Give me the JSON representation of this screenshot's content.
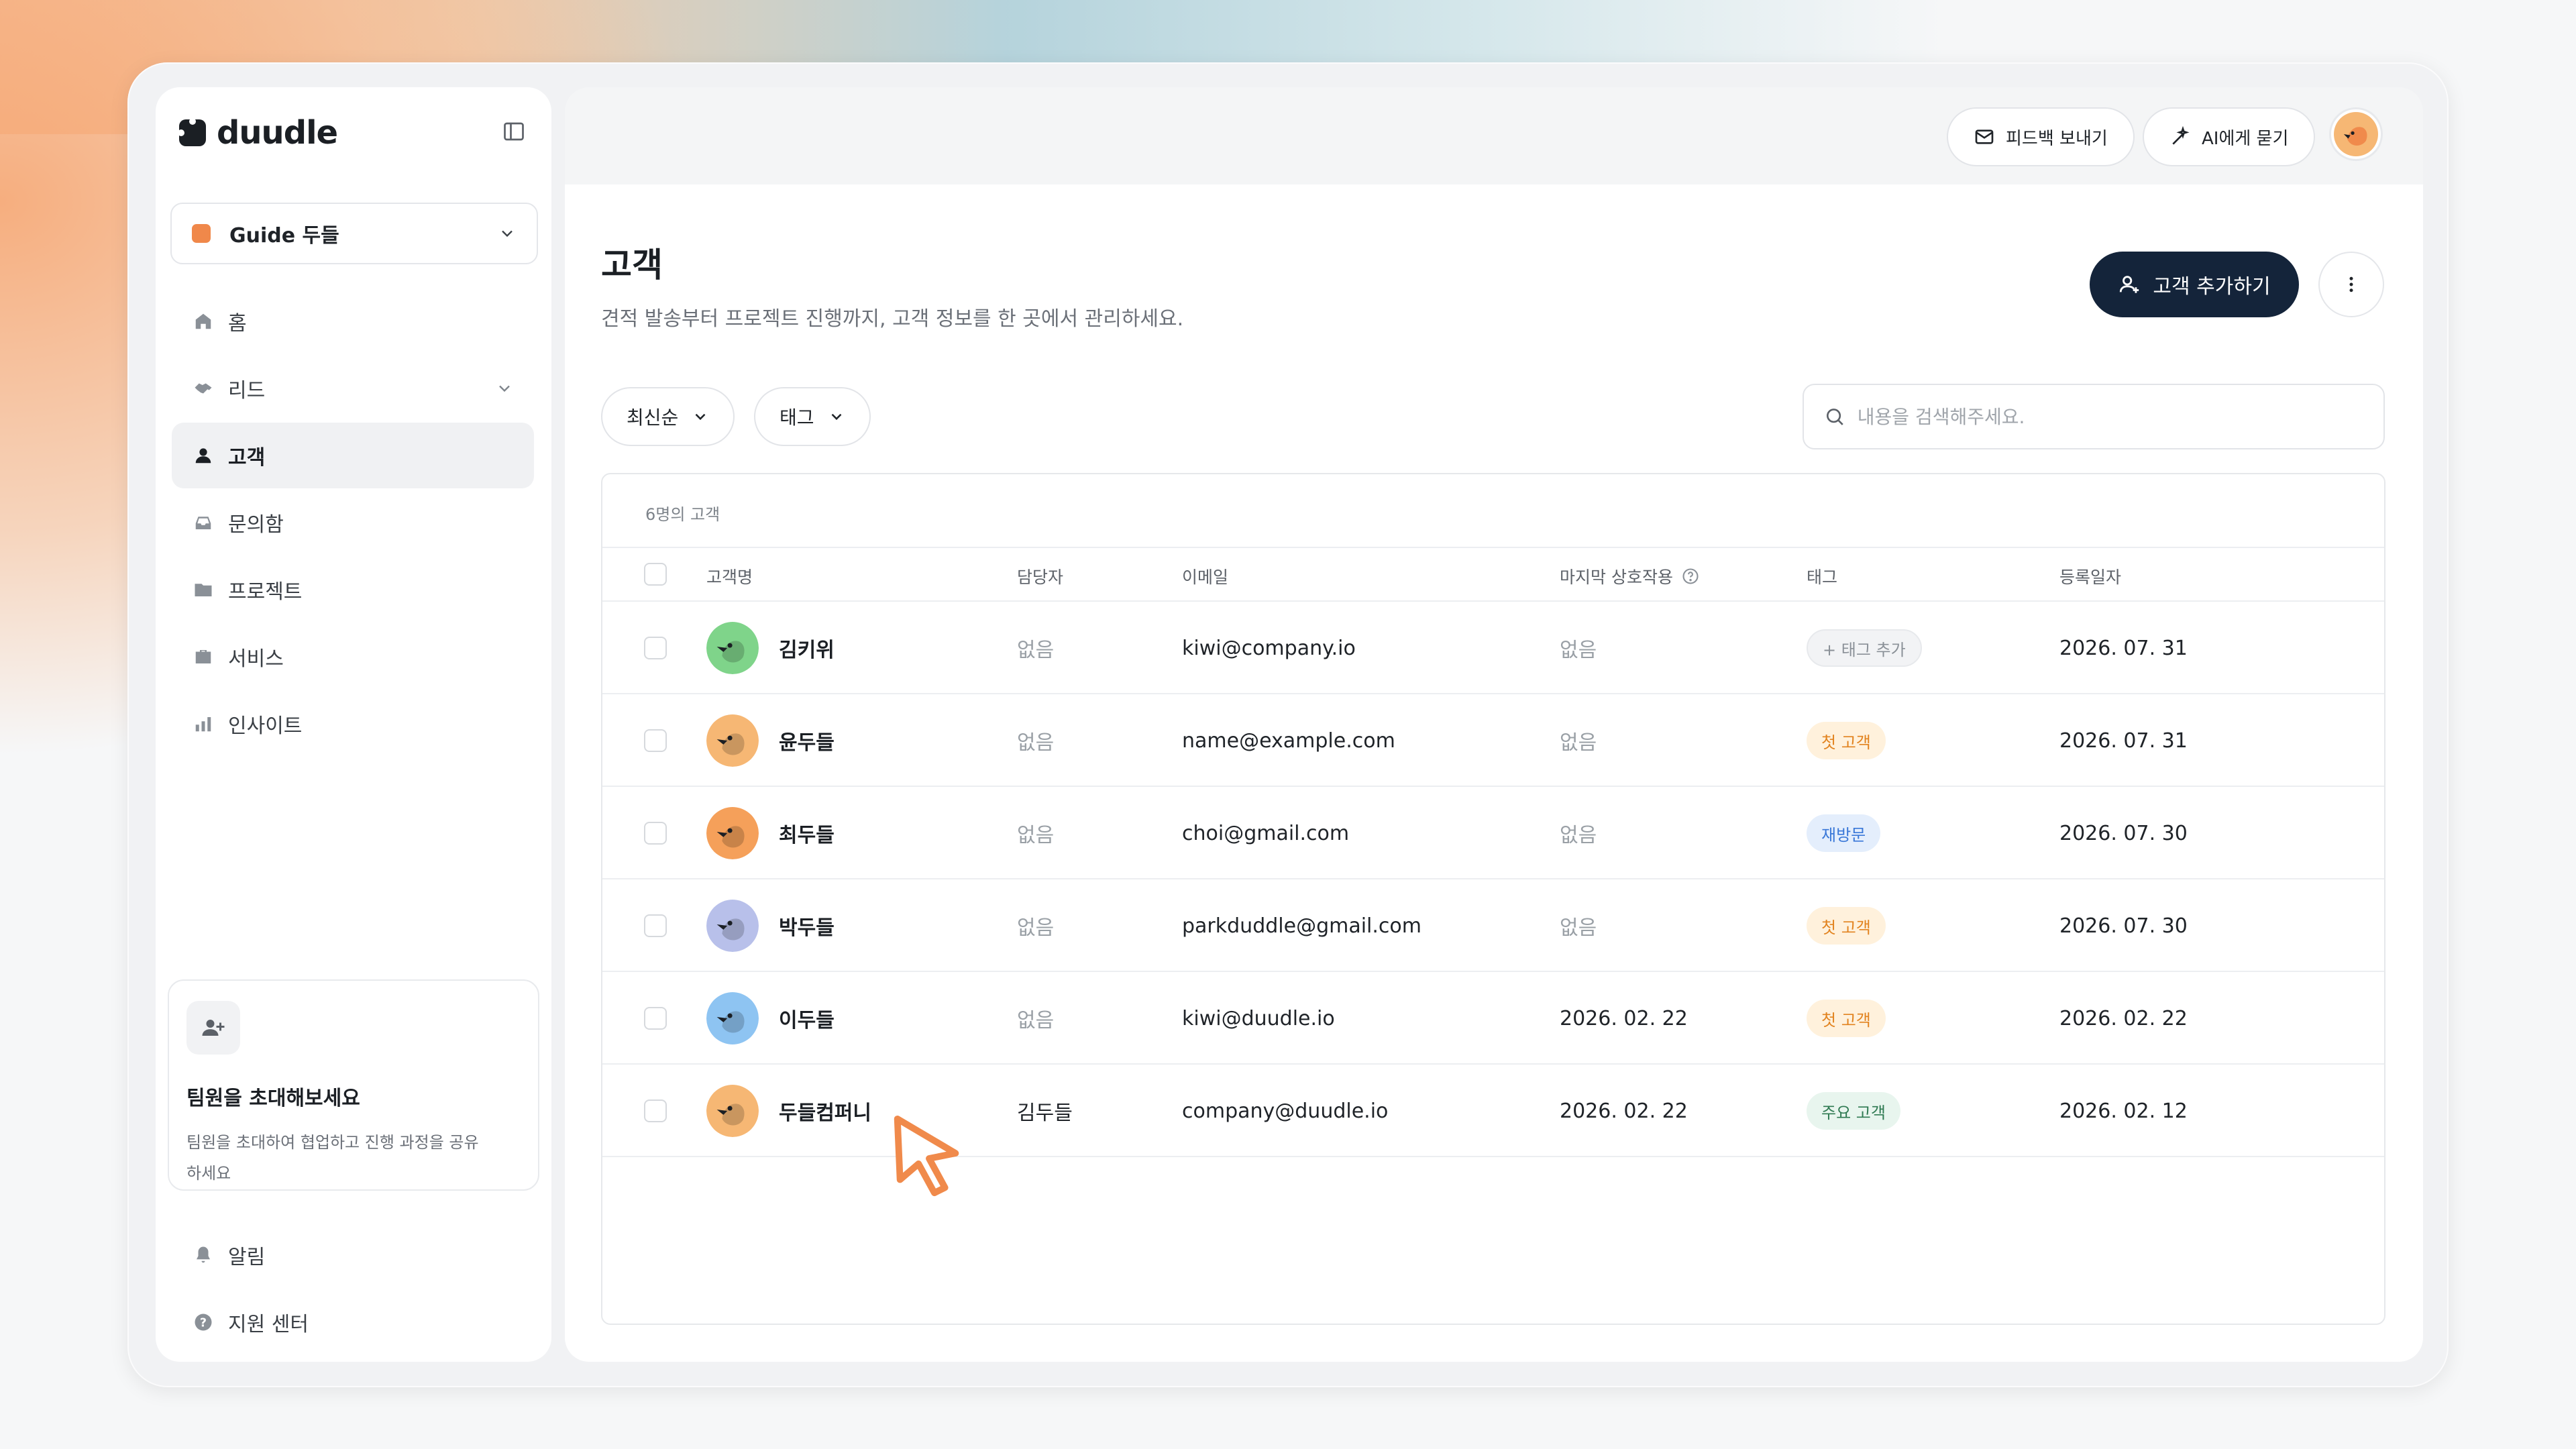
{
  "app": {
    "logo_text": "duudle",
    "workspace": "Guide 두들"
  },
  "sidebar": {
    "items": [
      {
        "label": "홈",
        "icon": "home-icon"
      },
      {
        "label": "리드",
        "icon": "handshake-icon"
      },
      {
        "label": "고객",
        "icon": "person-icon",
        "active": true
      },
      {
        "label": "문의함",
        "icon": "inbox-icon"
      },
      {
        "label": "프로젝트",
        "icon": "folder-icon"
      },
      {
        "label": "서비스",
        "icon": "briefcase-icon"
      },
      {
        "label": "인사이트",
        "icon": "bar-chart-icon"
      }
    ],
    "invite": {
      "title": "팀원을 초대해보세요",
      "desc": "팀원을 초대하여 협업하고 진행 과정을 공유하세요"
    },
    "bottom": [
      {
        "label": "알림",
        "icon": "bell-icon"
      },
      {
        "label": "지원 센터",
        "icon": "help-icon"
      }
    ]
  },
  "topbar": {
    "feedback_label": "피드백 보내기",
    "ai_label": "AI에게 묻기"
  },
  "page": {
    "title": "고객",
    "subtitle": "견적 발송부터 프로젝트 진행까지, 고객 정보를 한 곳에서 관리하세요.",
    "add_label": "고객 추가하기"
  },
  "filters": {
    "sort_label": "최신순",
    "tag_label": "태그",
    "search_placeholder": "내용을 검색해주세요."
  },
  "table": {
    "count_label": "6명의 고객",
    "headers": {
      "name": "고객명",
      "manager": "담당자",
      "email": "이메일",
      "last": "마지막 상호작용",
      "tag": "태그",
      "date": "등록일자"
    },
    "rows": [
      {
        "name": "김키위",
        "manager": "없음",
        "email": "kiwi@company.io",
        "last": "없음",
        "tag": "+ 태그 추가",
        "tag_style": "add",
        "date": "2026. 07. 31",
        "avatar_color": "#7fd48a"
      },
      {
        "name": "윤두들",
        "manager": "없음",
        "email": "name@example.com",
        "last": "없음",
        "tag": "첫 고객",
        "tag_style": "orange",
        "date": "2026. 07. 31",
        "avatar_color": "#f6b774"
      },
      {
        "name": "최두들",
        "manager": "없음",
        "email": "choi@gmail.com",
        "last": "없음",
        "tag": "재방문",
        "tag_style": "blue",
        "date": "2026. 07. 30",
        "avatar_color": "#f5a05a"
      },
      {
        "name": "박두들",
        "manager": "없음",
        "email": "parkduddle@gmail.com",
        "last": "없음",
        "tag": "첫 고객",
        "tag_style": "orange",
        "date": "2026. 07. 30",
        "avatar_color": "#b8c0ea"
      },
      {
        "name": "이두들",
        "manager": "없음",
        "email": "kiwi@duudle.io",
        "last": "2026. 02. 22",
        "tag": "첫 고객",
        "tag_style": "orange",
        "date": "2026. 02. 22",
        "avatar_color": "#8ec4f2"
      },
      {
        "name": "두들컴퍼니",
        "manager": "김두들",
        "email": "company@duudle.io",
        "last": "2026. 02. 22",
        "tag": "주요 고객",
        "tag_style": "green",
        "date": "2026. 02. 12",
        "avatar_color": "#f6b774"
      }
    ]
  },
  "colors": {
    "accent": "#14243a",
    "cursor": "#f08a4b"
  }
}
